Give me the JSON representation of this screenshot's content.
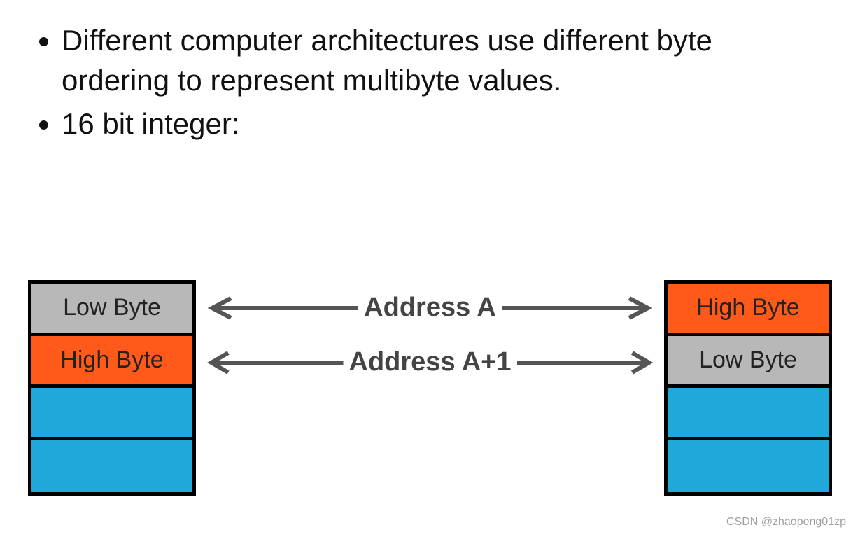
{
  "bullets": [
    "Different computer architectures use different byte ordering to represent multibyte values.",
    "16 bit integer:"
  ],
  "labels": {
    "row1": "Address A",
    "row2": "Address A+1"
  },
  "leftStack": {
    "cells": [
      {
        "text": "Low Byte",
        "color": "grey"
      },
      {
        "text": "High Byte",
        "color": "orange"
      },
      {
        "text": "",
        "color": "cyan"
      },
      {
        "text": "",
        "color": "cyan"
      }
    ]
  },
  "rightStack": {
    "cells": [
      {
        "text": "High Byte",
        "color": "orange"
      },
      {
        "text": "Low Byte",
        "color": "grey"
      },
      {
        "text": "",
        "color": "cyan"
      },
      {
        "text": "",
        "color": "cyan"
      }
    ]
  },
  "colors": {
    "grey": "#b8b8b8",
    "orange": "#ff5a1a",
    "cyan": "#1fa9d8",
    "text": "#222",
    "label": "#444"
  },
  "watermark": "CSDN @zhaopeng01zp"
}
